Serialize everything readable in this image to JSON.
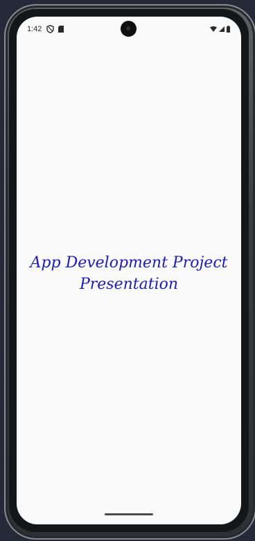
{
  "status_bar": {
    "time": "1:42",
    "left_icons": [
      "shield-icon",
      "sd-card-icon"
    ],
    "right_icons": [
      "wifi-icon",
      "cellular-signal-icon",
      "battery-icon"
    ]
  },
  "main": {
    "title_line1": "App Development Project",
    "title_line2": "Presentation",
    "title_color": "#1a1ad0"
  },
  "colors": {
    "screen_background": "#fafafa",
    "page_background": "#242a38"
  }
}
